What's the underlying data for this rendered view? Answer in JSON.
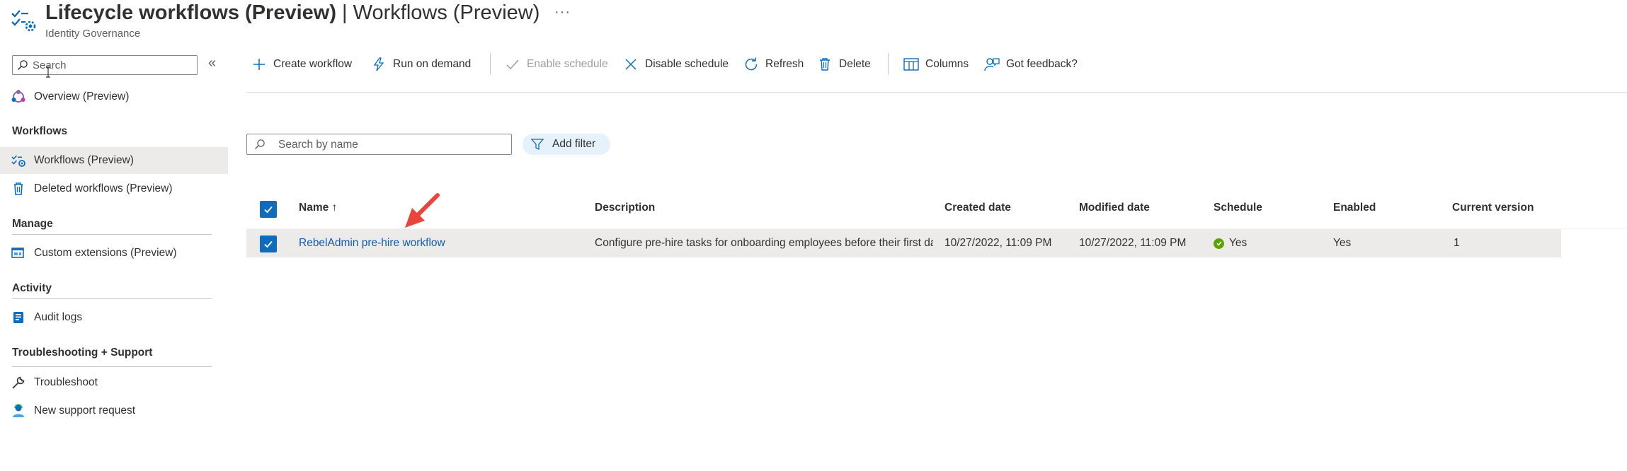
{
  "header": {
    "title_bold": "Lifecycle workflows (Preview)",
    "title_separator": " | ",
    "title_light": "Workflows (Preview)",
    "more": "···",
    "subtitle": "Identity Governance"
  },
  "sidebar": {
    "search_placeholder": "Search",
    "collapse": "«",
    "overview": "Overview (Preview)",
    "sections": {
      "workflows": "Workflows",
      "manage": "Manage",
      "activity": "Activity",
      "support": "Troubleshooting + Support"
    },
    "items": {
      "workflows": "Workflows (Preview)",
      "deleted": "Deleted workflows (Preview)",
      "custom_ext": "Custom extensions (Preview)",
      "audit": "Audit logs",
      "troubleshoot": "Troubleshoot",
      "support": "New support request"
    }
  },
  "toolbar": {
    "create": "Create workflow",
    "run": "Run on demand",
    "enable": "Enable schedule",
    "disable": "Disable schedule",
    "refresh": "Refresh",
    "delete": "Delete",
    "columns": "Columns",
    "feedback": "Got feedback?"
  },
  "filter": {
    "search_placeholder": "Search by name",
    "add_filter": "Add filter"
  },
  "table": {
    "columns": {
      "name": "Name",
      "sort": "↑",
      "description": "Description",
      "created": "Created date",
      "modified": "Modified date",
      "schedule": "Schedule",
      "enabled": "Enabled",
      "version": "Current version"
    },
    "rows": [
      {
        "name": "RebelAdmin pre-hire workflow",
        "description": "Configure pre-hire tasks for onboarding employees before their first day",
        "created": "10/27/2022, 11:09 PM",
        "modified": "10/27/2022, 11:09 PM",
        "schedule": "Yes",
        "enabled": "Yes",
        "version": "1"
      }
    ]
  },
  "colors": {
    "accent": "#0f6cbd",
    "link": "#0f5bb5",
    "success": "#57a300",
    "arrow": "#e8453c"
  }
}
